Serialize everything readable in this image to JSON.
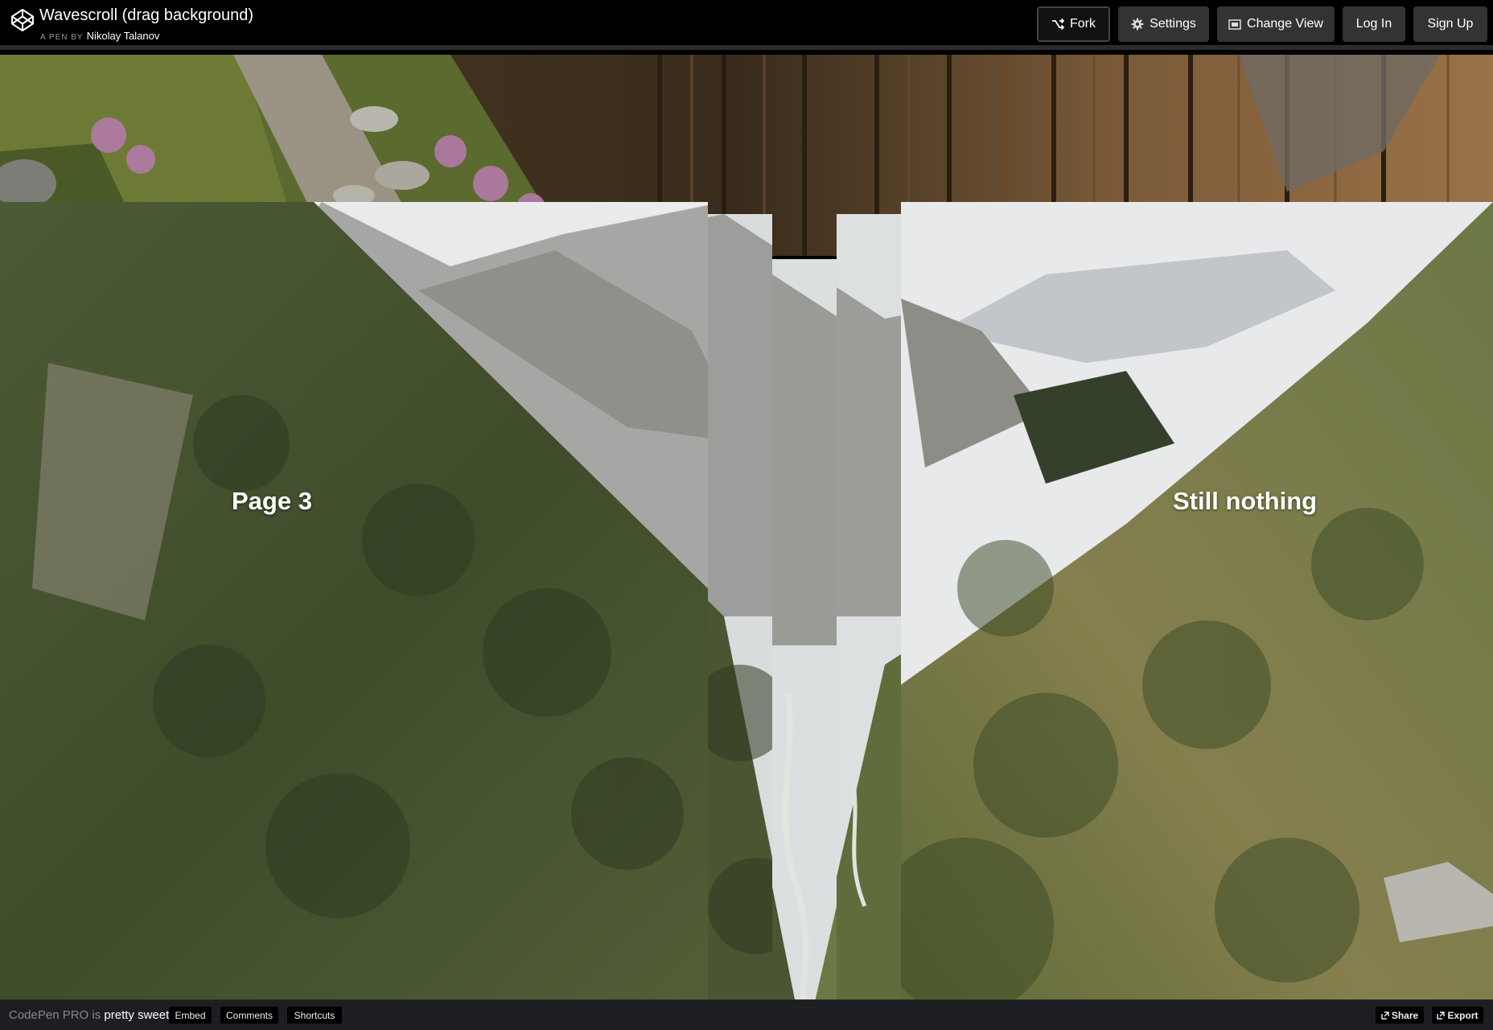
{
  "header": {
    "title": "Wavescroll (drag background)",
    "byline_prefix": "A PEN BY",
    "author": "Nikolay Talanov",
    "buttons": {
      "fork": "Fork",
      "settings": "Settings",
      "change_view": "Change View",
      "log_in": "Log In",
      "sign_up": "Sign Up"
    }
  },
  "content": {
    "left_label": "Page 3",
    "right_label": "Still nothing"
  },
  "footer": {
    "promo_prefix": "CodePen PRO is",
    "promo_highlight": "pretty sweet.",
    "embed": "Embed",
    "comments": "Comments",
    "shortcuts": "Shortcuts",
    "share": "Share",
    "export": "Export"
  },
  "icons": {
    "logo": "codepen-logo-icon",
    "fork": "fork-icon",
    "settings": "gear-icon",
    "change_view": "layout-icon",
    "share": "share-icon",
    "export": "export-icon"
  },
  "colors": {
    "header_bg": "#000000",
    "button_bg": "#333333",
    "footer_bg": "#1d1e22"
  }
}
